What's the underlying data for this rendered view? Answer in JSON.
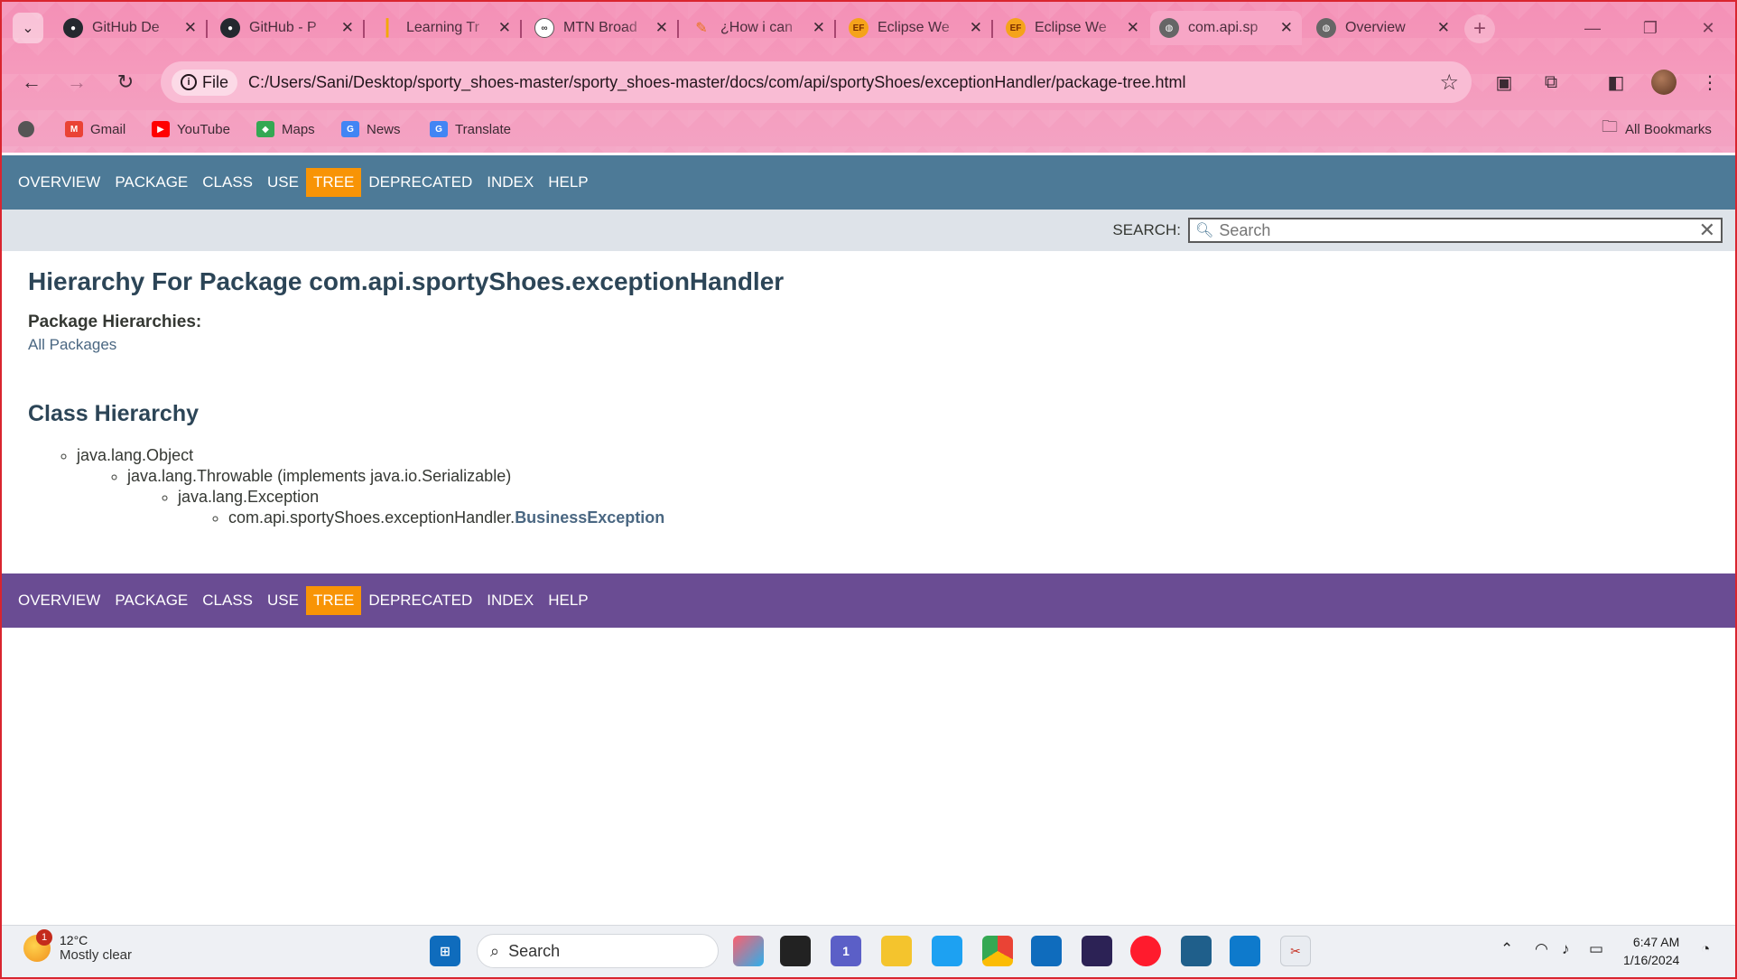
{
  "browser": {
    "tabs": [
      {
        "title": "GitHub De",
        "favicon": "github-icon",
        "color": "#24292f",
        "active": false
      },
      {
        "title": "GitHub - P",
        "favicon": "github-icon",
        "color": "#24292f",
        "active": false
      },
      {
        "title": "Learning Tr",
        "favicon": "bar-chart-icon",
        "color": "#f2a900",
        "active": false
      },
      {
        "title": "MTN Broad",
        "favicon": "mtn-icon",
        "color": "#555555",
        "active": false
      },
      {
        "title": "¿How i can",
        "favicon": "pen-icon",
        "color": "#e8731b",
        "active": false
      },
      {
        "title": "Eclipse We",
        "favicon": "ef-icon",
        "color": "#f5a31a",
        "active": false
      },
      {
        "title": "Eclipse We",
        "favicon": "ef-icon",
        "color": "#f5a31a",
        "active": false
      },
      {
        "title": "com.api.sp",
        "favicon": "globe-icon",
        "color": "#555555",
        "active": true
      },
      {
        "title": "Overview",
        "favicon": "globe-icon",
        "color": "#555555",
        "active": false
      }
    ],
    "address": {
      "chip_label": "File",
      "url": "C:/Users/Sani/Desktop/sporty_shoes-master/sporty_shoes-master/docs/com/api/sportyShoes/exceptionHandler/package-tree.html"
    },
    "bookmarks": [
      {
        "label": "Gmail",
        "icon": "gmail-icon",
        "color": "#ea4335"
      },
      {
        "label": "YouTube",
        "icon": "youtube-icon",
        "color": "#ff0000"
      },
      {
        "label": "Maps",
        "icon": "maps-icon",
        "color": "#34a853"
      },
      {
        "label": "News",
        "icon": "news-icon",
        "color": "#4285f4"
      },
      {
        "label": "Translate",
        "icon": "translate-icon",
        "color": "#4285f4"
      }
    ],
    "all_bookmarks_label": "All Bookmarks"
  },
  "page": {
    "nav_items": [
      "Overview",
      "Package",
      "Class",
      "Use",
      "Tree",
      "Deprecated",
      "Index",
      "Help"
    ],
    "active_nav": "Tree",
    "search_label": "SEARCH:",
    "search_placeholder": "Search",
    "title": "Hierarchy For Package com.api.sportyShoes.exceptionHandler",
    "package_hierarchies_label": "Package Hierarchies:",
    "all_packages_link": "All Packages",
    "class_hierarchy_title": "Class Hierarchy",
    "tree": {
      "level1": "java.lang.Object",
      "level2": "java.lang.Throwable (implements java.io.Serializable)",
      "level3": "java.lang.Exception",
      "level4_prefix": "com.api.sportyShoes.exceptionHandler.",
      "level4_link": "BusinessException"
    },
    "colors": {
      "top_nav": "#4d7a97",
      "bottom_nav": "#6a4c93",
      "active_nav": "#f89406"
    }
  },
  "taskbar": {
    "weather": {
      "temp": "12°C",
      "condition": "Mostly clear",
      "badge": "1"
    },
    "search_label": "Search",
    "teams_badge": "1",
    "time": "6:47 AM",
    "date": "1/16/2024"
  }
}
